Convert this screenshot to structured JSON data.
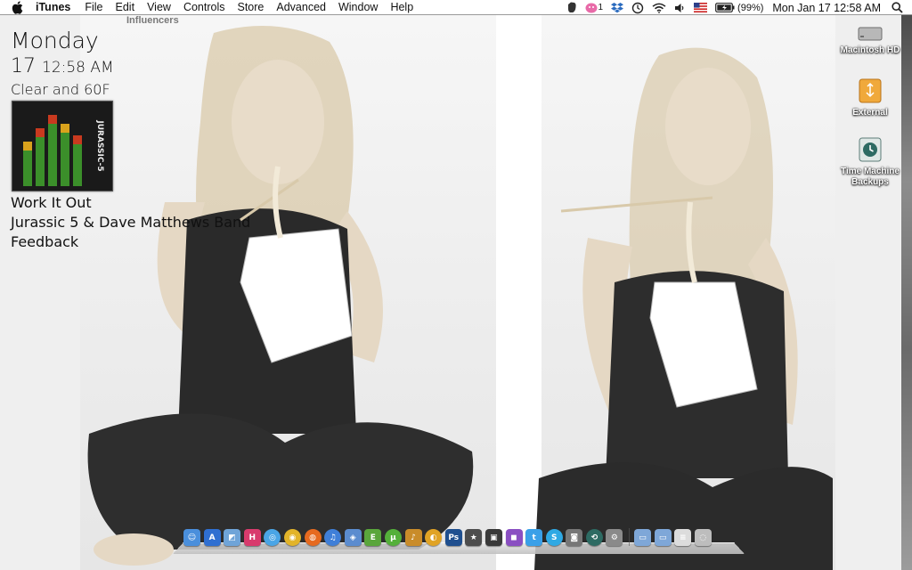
{
  "menubar": {
    "app_name": "iTunes",
    "menus": [
      "File",
      "Edit",
      "View",
      "Controls",
      "Store",
      "Advanced",
      "Window",
      "Help"
    ],
    "status_icons": [
      "evernote-icon",
      "growl-icon",
      "dropbox-icon",
      "time-machine-icon",
      "wifi-icon",
      "volume-icon",
      "flag-us-icon",
      "battery-icon"
    ],
    "notification_count": "1",
    "battery_percent": "(99%)",
    "clock": "Mon Jan 17  12:58 AM"
  },
  "background_window": {
    "title": "Influencers"
  },
  "geektool": {
    "day": "Monday",
    "date_number": "17",
    "time": "12:58 AM",
    "weather": "Clear and 60F"
  },
  "now_playing": {
    "song": "Work It Out",
    "artist": "Jurassic 5 & Dave Matthews Band",
    "album": "Feedback",
    "album_art_text": "JURASSIC-5"
  },
  "desktop_icons": [
    {
      "label": "Macintosh HD",
      "icon": "hard-drive-icon"
    },
    {
      "label": "External",
      "icon": "usb-drive-icon"
    },
    {
      "label": "Time Machine Backups",
      "icon": "time-machine-icon"
    }
  ],
  "dock": {
    "apps": [
      {
        "name": "finder-icon",
        "color": "#4a8fdc",
        "glyph": "☺"
      },
      {
        "name": "app-store-icon",
        "color": "#2f6fd1",
        "glyph": "A"
      },
      {
        "name": "preview-icon",
        "color": "#6fa4d8",
        "glyph": "◩"
      },
      {
        "name": "haley-icon",
        "color": "#d83b6d",
        "glyph": "H"
      },
      {
        "name": "safari-icon",
        "color": "#4aa5e6",
        "glyph": "◎"
      },
      {
        "name": "chrome-icon",
        "color": "#e2b42a",
        "glyph": "◉"
      },
      {
        "name": "firefox-icon",
        "color": "#e66a1f",
        "glyph": "◍"
      },
      {
        "name": "itunes-icon",
        "color": "#3f7fd8",
        "glyph": "♫"
      },
      {
        "name": "app-icon",
        "color": "#5b8ccf",
        "glyph": "◈"
      },
      {
        "name": "evernote-icon",
        "color": "#5aa63c",
        "glyph": "E"
      },
      {
        "name": "utorrent-icon",
        "color": "#54b03a",
        "glyph": "µ"
      },
      {
        "name": "garageband-icon",
        "color": "#c98c2a",
        "glyph": "♪"
      },
      {
        "name": "audio-icon",
        "color": "#e0a325",
        "glyph": "◐"
      },
      {
        "name": "photoshop-icon",
        "color": "#1f4f8f",
        "glyph": "Ps"
      },
      {
        "name": "imovie-icon",
        "color": "#4d4d4d",
        "glyph": "★"
      },
      {
        "name": "clapper-icon",
        "color": "#3a3a3a",
        "glyph": "▣"
      },
      {
        "name": "movie-icon",
        "color": "#8a4fc2",
        "glyph": "◼"
      },
      {
        "name": "twitter-icon",
        "color": "#3aa0e8",
        "glyph": "t"
      },
      {
        "name": "skype-icon",
        "color": "#2fa9e4",
        "glyph": "S"
      },
      {
        "name": "camera-icon",
        "color": "#777777",
        "glyph": "◙"
      },
      {
        "name": "time-machine-icon",
        "color": "#2d6b63",
        "glyph": "⟲"
      },
      {
        "name": "system-preferences-icon",
        "color": "#8a8a8a",
        "glyph": "⚙"
      }
    ],
    "stacks": [
      {
        "name": "applications-folder-icon",
        "color": "#7ea7d8",
        "glyph": "▭"
      },
      {
        "name": "documents-folder-icon",
        "color": "#7ea7d8",
        "glyph": "▭"
      },
      {
        "name": "downloads-stack-icon",
        "color": "#dcdcdc",
        "glyph": "≡"
      },
      {
        "name": "trash-icon",
        "color": "#bdbdbd",
        "glyph": "◌"
      }
    ]
  },
  "colors": {
    "menubar_bg": "#ffffff",
    "text": "#111111",
    "wallpaper": "#efefef"
  }
}
